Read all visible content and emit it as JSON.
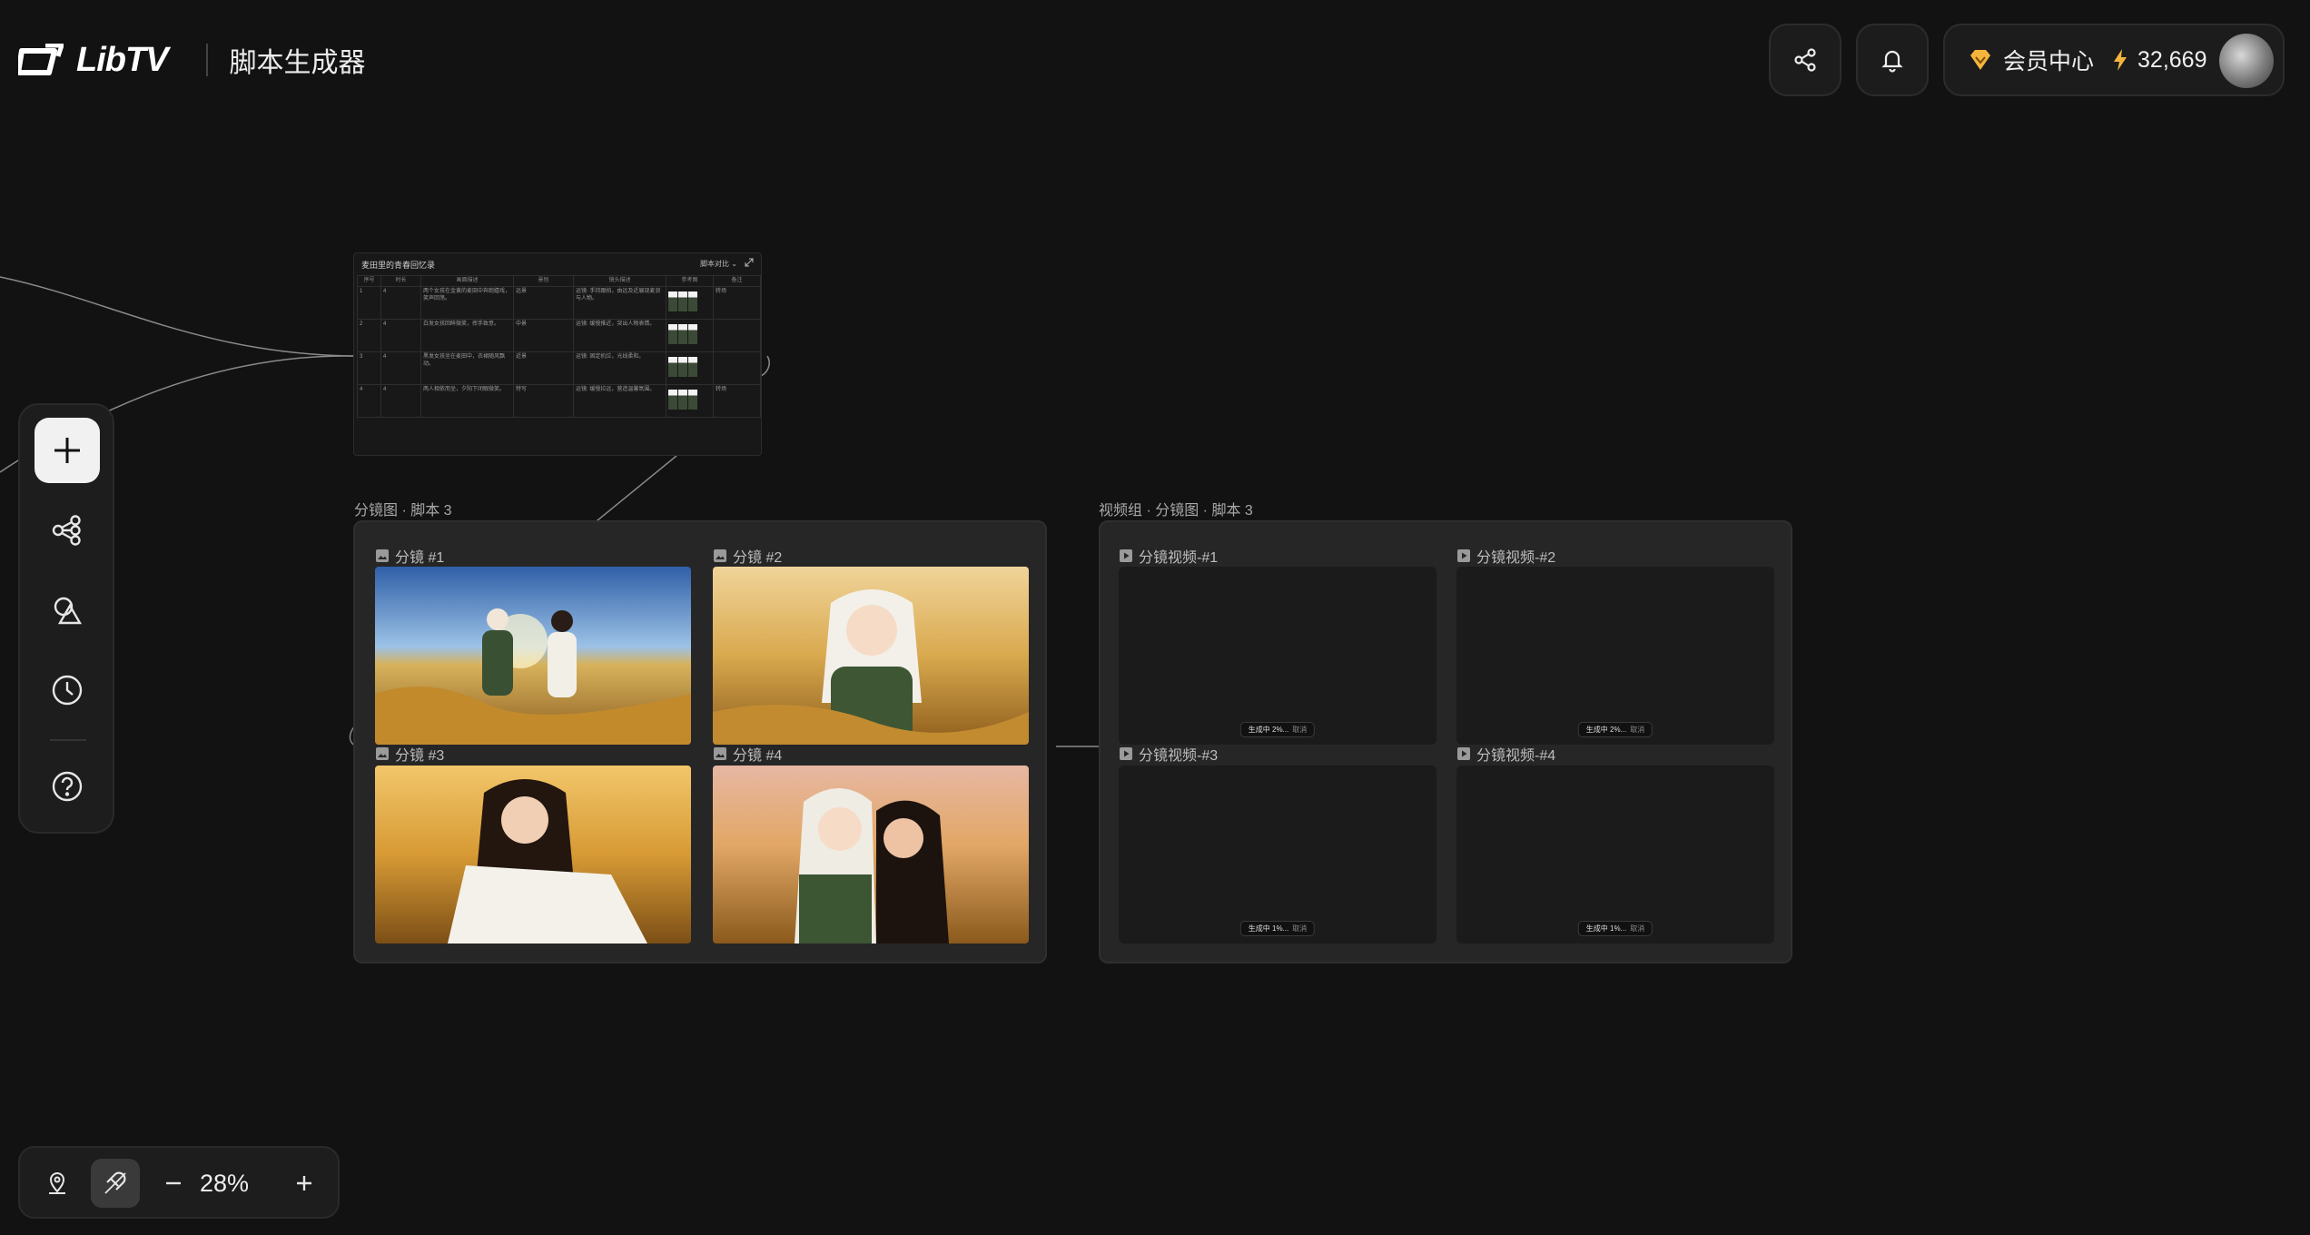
{
  "header": {
    "brand": "LibTV",
    "app_title": "脚本生成器",
    "member_label": "会员中心",
    "credits": "32,669"
  },
  "zoom": {
    "level": "28%"
  },
  "script_table": {
    "title": "麦田里的青春回忆录",
    "version_label": "脚本对比 ⌄",
    "columns": [
      "序号",
      "时长",
      "画面描述",
      "景别",
      "镜头描述",
      "参考图",
      "备注"
    ],
    "rows": [
      {
        "idx": "1",
        "dur": "4",
        "desc": "两个女孩在金黄的麦田中奔跑嬉戏，笑声回荡。",
        "shot": "远景",
        "cam": "运镜: 手持跟拍，由远及近展现麦浪与人物。",
        "note": "转场"
      },
      {
        "idx": "2",
        "dur": "4",
        "desc": "白发女孩回眸微笑，挥手致意。",
        "shot": "中景",
        "cam": "运镜: 缓慢推近，突出人物表情。",
        "note": ""
      },
      {
        "idx": "3",
        "dur": "4",
        "desc": "黑发女孩坐在麦田中，衣裙随风飘动。",
        "shot": "近景",
        "cam": "运镜: 固定机位，光线柔和。",
        "note": ""
      },
      {
        "idx": "4",
        "dur": "4",
        "desc": "两人相依而坐，夕阳下闭眼微笑。",
        "shot": "特写",
        "cam": "运镜: 缓慢拉远，营造温馨氛围。",
        "note": "转场"
      }
    ]
  },
  "storyboard_group": {
    "title": "分镜图 · 脚本 3",
    "items": [
      {
        "label": "分镜 #1"
      },
      {
        "label": "分镜 #2"
      },
      {
        "label": "分镜 #3"
      },
      {
        "label": "分镜 #4"
      }
    ]
  },
  "video_group": {
    "title": "视频组 · 分镜图 · 脚本 3",
    "items": [
      {
        "label": "分镜视频-#1",
        "status": "生成中 2%...",
        "cancel": "取消"
      },
      {
        "label": "分镜视频-#2",
        "status": "生成中 2%...",
        "cancel": "取消"
      },
      {
        "label": "分镜视频-#3",
        "status": "生成中 1%...",
        "cancel": "取消"
      },
      {
        "label": "分镜视频-#4",
        "status": "生成中 1%...",
        "cancel": "取消"
      }
    ]
  },
  "icons": {
    "share": "share-icon",
    "bell": "bell-icon",
    "vip": "diamond-icon",
    "bolt": "lightning-icon",
    "add": "plus-icon",
    "workflow": "workflow-icon",
    "shapes": "shapes-icon",
    "history": "clock-icon",
    "help": "help-icon",
    "locate": "map-pin-icon",
    "magnet": "magnet-icon",
    "zoom_out": "minus-icon",
    "zoom_in": "plus-icon"
  },
  "colors": {
    "background": "#121212",
    "panel": "#262626",
    "accent_gold": "#f5b53d"
  }
}
